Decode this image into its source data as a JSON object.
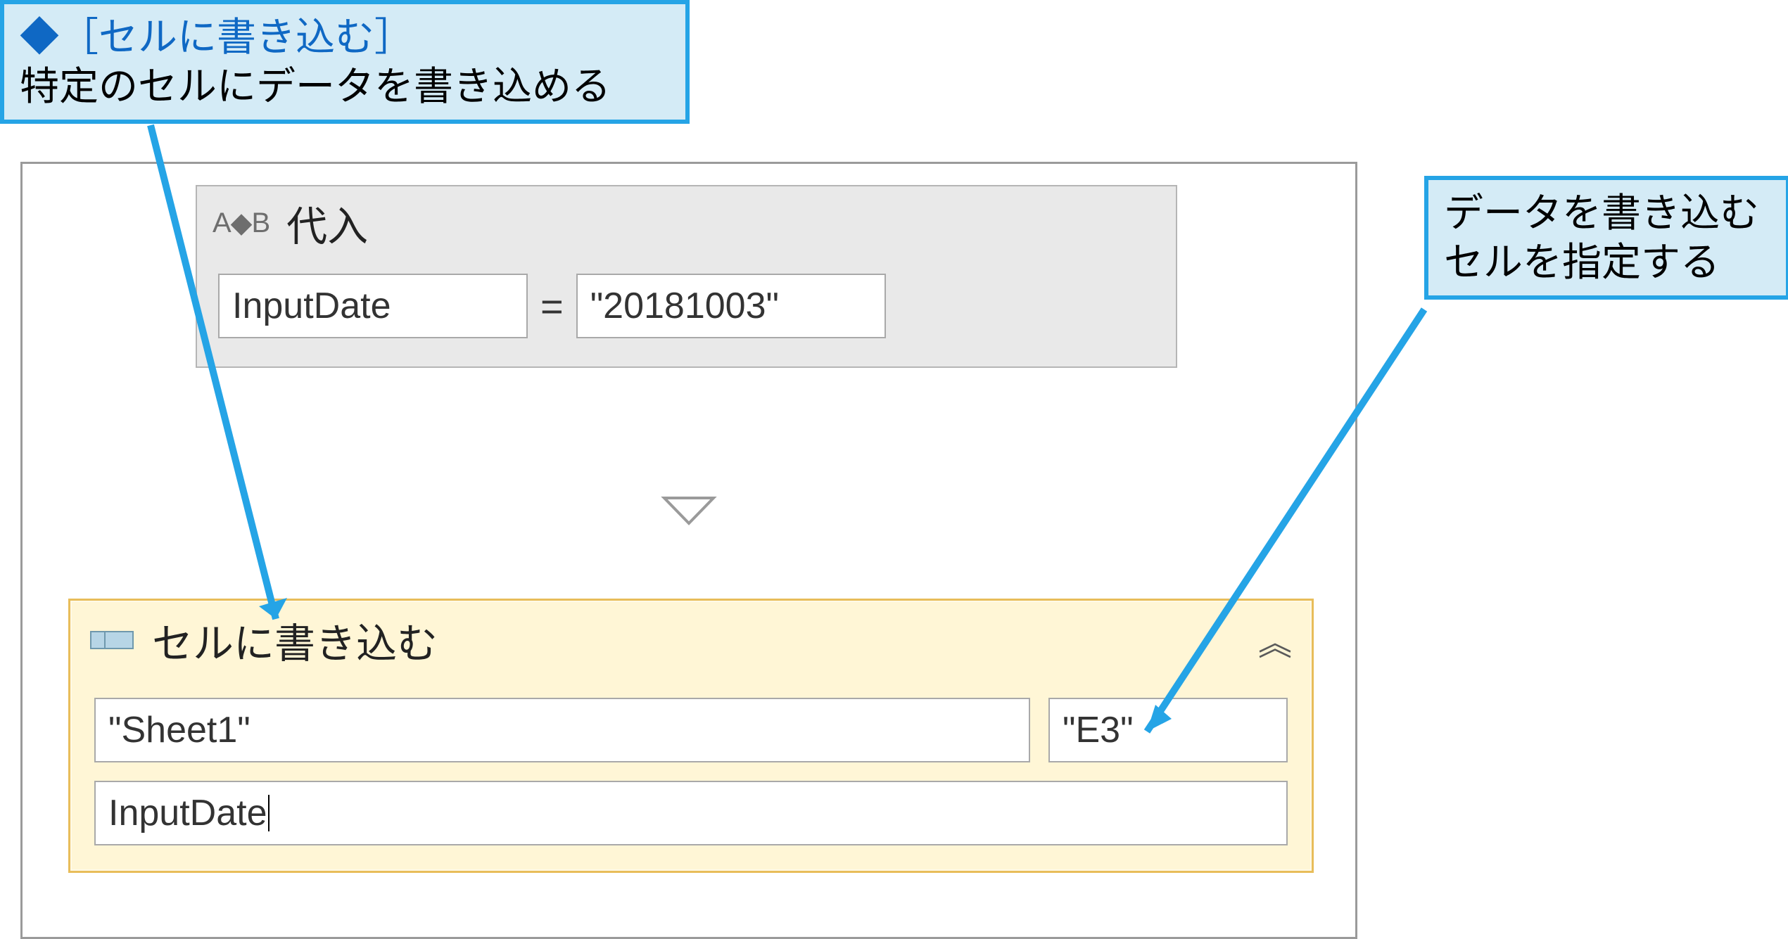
{
  "callouts": {
    "top": {
      "title": "◆［セルに書き込む］",
      "body": "特定のセルにデータを書き込める"
    },
    "right": {
      "line1": "データを書き込む",
      "line2": "セルを指定する"
    }
  },
  "activities": {
    "assign": {
      "icon_label": "A⬩B",
      "title": "代入",
      "variable": "InputDate",
      "equals": "=",
      "value": "\"20181003\""
    },
    "writeCell": {
      "title": "セルに書き込む",
      "sheet": "\"Sheet1\"",
      "cell": "\"E3\"",
      "value": "InputDate"
    }
  }
}
